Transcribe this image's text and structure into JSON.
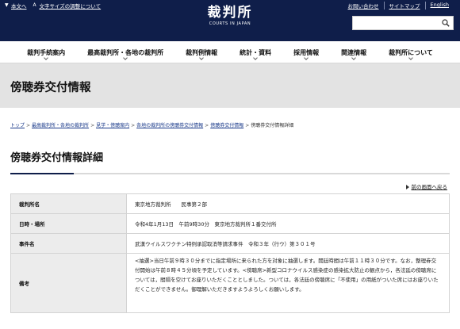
{
  "header": {
    "util_left": {
      "home": "本文へ",
      "text_size_icon": "A",
      "text_size": "文字サイズの調整について"
    },
    "logo": {
      "title": "裁判所",
      "subtitle": "COURTS IN JAPAN"
    },
    "util_right": [
      "お問い合わせ",
      "サイトマップ",
      "English"
    ],
    "search": {
      "value": "",
      "placeholder": ""
    }
  },
  "nav": [
    "裁判手続案内",
    "最高裁判所・各地の裁判所",
    "裁判例情報",
    "統計・資料",
    "採用情報",
    "関連情報",
    "裁判所について"
  ],
  "banner": {
    "title": "傍聴券交付情報"
  },
  "breadcrumb": {
    "links": [
      "トップ",
      "最高裁判所・各地の裁判所",
      "見学・傍聴案内",
      "各地の裁判所の傍聴券交付情報",
      "傍聴券交付情報"
    ],
    "separator": ">",
    "current": "傍聴券交付情報詳細"
  },
  "page": {
    "title": "傍聴券交付情報詳細",
    "back_link": "前の画面へ戻る"
  },
  "details": {
    "court_label": "裁判所名",
    "court_value": "東京地方裁判所　　民事第２部",
    "datetime_label": "日時・場所",
    "datetime_value": "令和4年1月13日　午前9時30分　東京地方裁判所１番交付所",
    "case_label": "事件名",
    "case_value": "武漢ウイルスワクチン特例承認取消等請求事件　令和３年（行ウ）第３０１号",
    "notes_label": "備考",
    "notes_value": "<抽選>当日午前９時３０分までに指定場所に来られた方を対象に抽選します。開廷時間は午前１１時３０分です。なお，整理券交付開始は午前８時４５分頃を予定しています。<傍聴席>新型コロナウイルス感染症の感染拡大防止の観点から，各法廷の傍聴席については，間隔を空けてお座りいただくこととしました。ついては，各法廷の傍聴席に「不使用」の用紙がついた席にはお座りいただくことができません。御理解いただきますようよろしくお願いします。"
  },
  "colors": {
    "header_bg": "#0f1e4a",
    "banner_bg": "#e3e3e3",
    "table_header_bg": "#ececec",
    "link": "#1a3a8a"
  }
}
